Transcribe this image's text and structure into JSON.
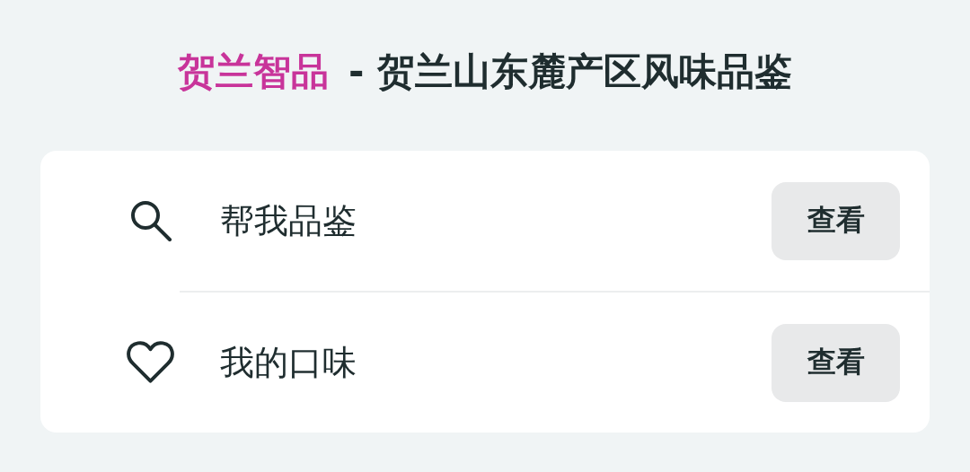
{
  "header": {
    "brand": "贺兰智品",
    "title": "- 贺兰山东麓产区风味品鉴"
  },
  "rows": [
    {
      "kind": "search",
      "label": "帮我品鉴",
      "button": "查看"
    },
    {
      "kind": "heart",
      "label": "我的口味",
      "button": "查看"
    }
  ]
}
